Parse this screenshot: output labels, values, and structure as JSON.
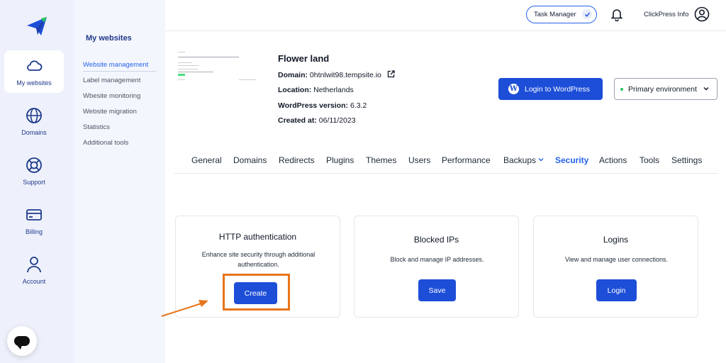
{
  "rail": {
    "items": [
      {
        "label": "My websites",
        "icon": "cloud-icon"
      },
      {
        "label": "Domains",
        "icon": "globe-icon"
      },
      {
        "label": "Support",
        "icon": "lifebuoy-icon"
      },
      {
        "label": "Billing",
        "icon": "credit-card-icon"
      },
      {
        "label": "Account",
        "icon": "user-icon"
      }
    ]
  },
  "subnav": {
    "title": "My websites",
    "items": [
      {
        "label": "Website management"
      },
      {
        "label": "Label management"
      },
      {
        "label": "Wbesite monitoring"
      },
      {
        "label": "Website migration"
      },
      {
        "label": "Statistics"
      },
      {
        "label": "Additional tools"
      }
    ]
  },
  "topbar": {
    "task_manager": "Task Manager",
    "user_name": "ClickPress Info"
  },
  "site": {
    "title": "Flower land",
    "domain_label": "Domain:",
    "domain_value": "0htnlwit98.tempsite.io",
    "location_label": "Location:",
    "location_value": "Netherlands",
    "wp_version_label": "WordPress version:",
    "wp_version_value": "6.3.2",
    "created_label": "Created at:",
    "created_value": "06/11/2023"
  },
  "actions": {
    "login_wp": "Login to WordPress",
    "environment": "Primary environment"
  },
  "tabs": [
    {
      "label": "General"
    },
    {
      "label": "Domains"
    },
    {
      "label": "Redirects"
    },
    {
      "label": "Plugins"
    },
    {
      "label": "Themes"
    },
    {
      "label": "Users"
    },
    {
      "label": "Performance"
    },
    {
      "label": "Backups"
    },
    {
      "label": "Security"
    },
    {
      "label": "Actions"
    },
    {
      "label": "Tools"
    },
    {
      "label": "Settings"
    }
  ],
  "cards": [
    {
      "title": "HTTP authentication",
      "desc": "Enhance site security through additional authentication.",
      "button": "Create"
    },
    {
      "title": "Blocked IPs",
      "desc": "Block and manage IP addresses.",
      "button": "Save"
    },
    {
      "title": "Logins",
      "desc": "View and manage user connections.",
      "button": "Login"
    }
  ],
  "colors": {
    "primary": "#1d4ed8",
    "active_link": "#2563eb",
    "highlight": "#e8751a",
    "rail_bg": "#eef1fb"
  }
}
